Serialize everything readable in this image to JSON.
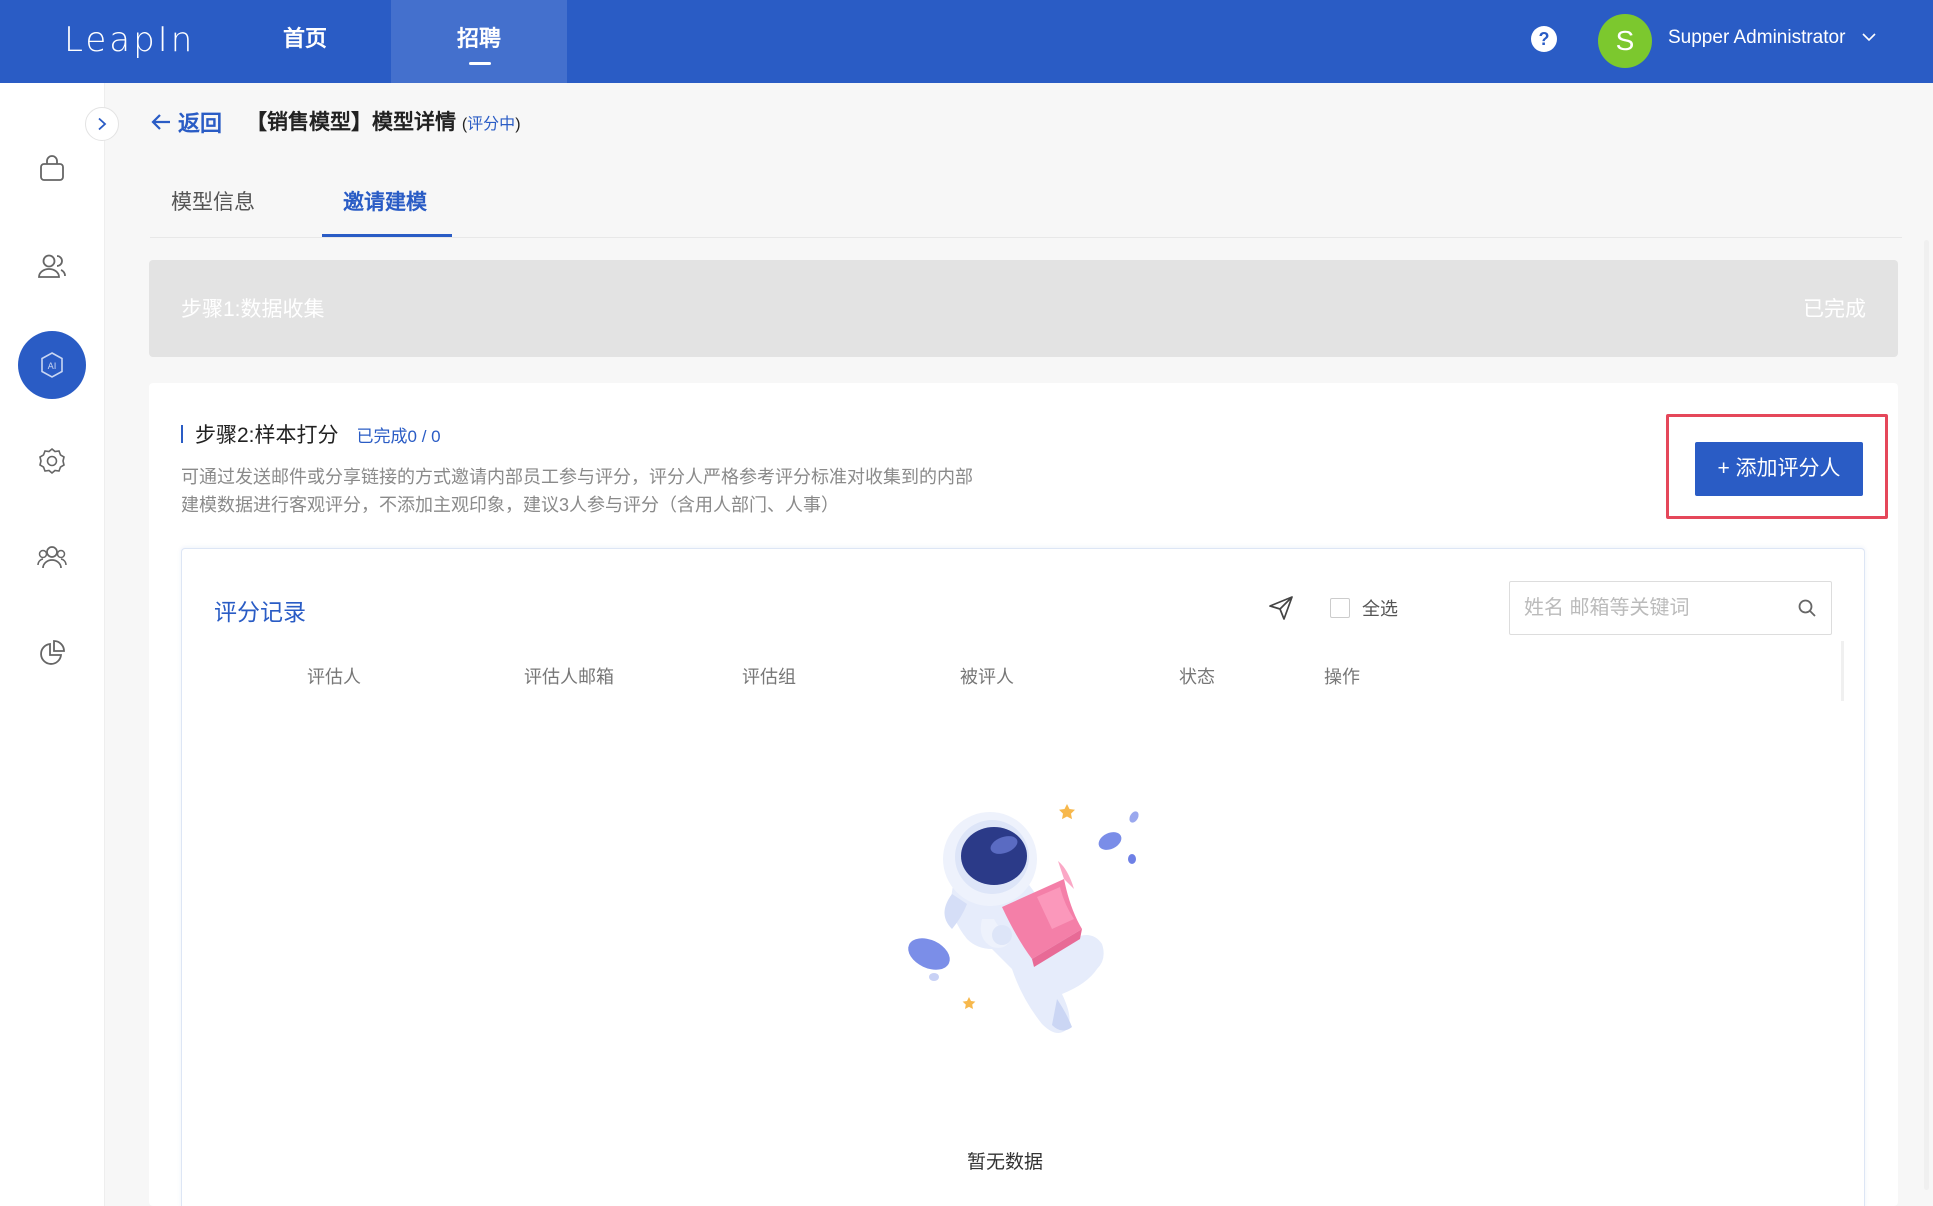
{
  "header": {
    "logo": "LeapIn",
    "nav": [
      {
        "label": "首页"
      },
      {
        "label": "招聘"
      }
    ],
    "help": "?",
    "user": {
      "avatar_letter": "S",
      "name": "Supper Administrator"
    }
  },
  "sidebar": {
    "items": [
      "bag-icon",
      "users-icon",
      "ai-icon",
      "settings-icon",
      "team-icon",
      "chart-icon"
    ],
    "active": "ai-icon"
  },
  "page": {
    "back": "返回",
    "title": "【销售模型】模型详情",
    "status_open": "(",
    "status": "评分中",
    "status_close": ")"
  },
  "tabs": [
    {
      "label": "模型信息"
    },
    {
      "label": "邀请建模"
    }
  ],
  "step1": {
    "title": "步骤1:数据收集",
    "status": "已完成"
  },
  "step2": {
    "title": "步骤2:样本打分",
    "progress": "已完成0 / 0",
    "description": "可通过发送邮件或分享链接的方式邀请内部员工参与评分，评分人严格参考评分标准对收集到的内部建模数据进行客观评分，不添加主观印象，建议3人参与评分（含用人部门、人事）",
    "add_button": "+ 添加评分人"
  },
  "records": {
    "title": "评分记录",
    "select_all": "全选",
    "search_placeholder": "姓名 邮箱等关键词",
    "columns": [
      "评估人",
      "评估人邮箱",
      "评估组",
      "被评人",
      "状态",
      "操作"
    ],
    "empty_text": "暂无数据"
  },
  "colors": {
    "primary": "#2a5cc5",
    "highlight": "#e5475a",
    "avatar": "#7cc82e"
  }
}
